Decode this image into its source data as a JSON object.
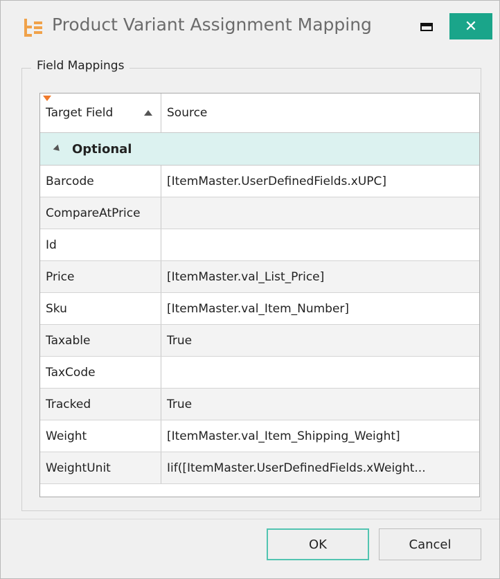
{
  "window": {
    "title": "Product Variant Assignment Mapping",
    "close_glyph": "✕",
    "accent_color": "#1aa58a"
  },
  "group": {
    "legend": "Field Mappings"
  },
  "grid": {
    "columns": [
      "Target Field",
      "Source"
    ],
    "sort": "ascending",
    "group_label": "Optional",
    "rows": [
      {
        "target": "Barcode",
        "source": "[ItemMaster.UserDefinedFields.xUPC]"
      },
      {
        "target": "CompareAtPrice",
        "source": ""
      },
      {
        "target": "Id",
        "source": ""
      },
      {
        "target": "Price",
        "source": "[ItemMaster.val_List_Price]"
      },
      {
        "target": "Sku",
        "source": "[ItemMaster.val_Item_Number]"
      },
      {
        "target": "Taxable",
        "source": "True"
      },
      {
        "target": "TaxCode",
        "source": ""
      },
      {
        "target": "Tracked",
        "source": "True"
      },
      {
        "target": "Weight",
        "source": "[ItemMaster.val_Item_Shipping_Weight]"
      },
      {
        "target": "WeightUnit",
        "source": "Iif([ItemMaster.UserDefinedFields.xWeight..."
      }
    ]
  },
  "buttons": {
    "ok": "OK",
    "cancel": "Cancel"
  }
}
